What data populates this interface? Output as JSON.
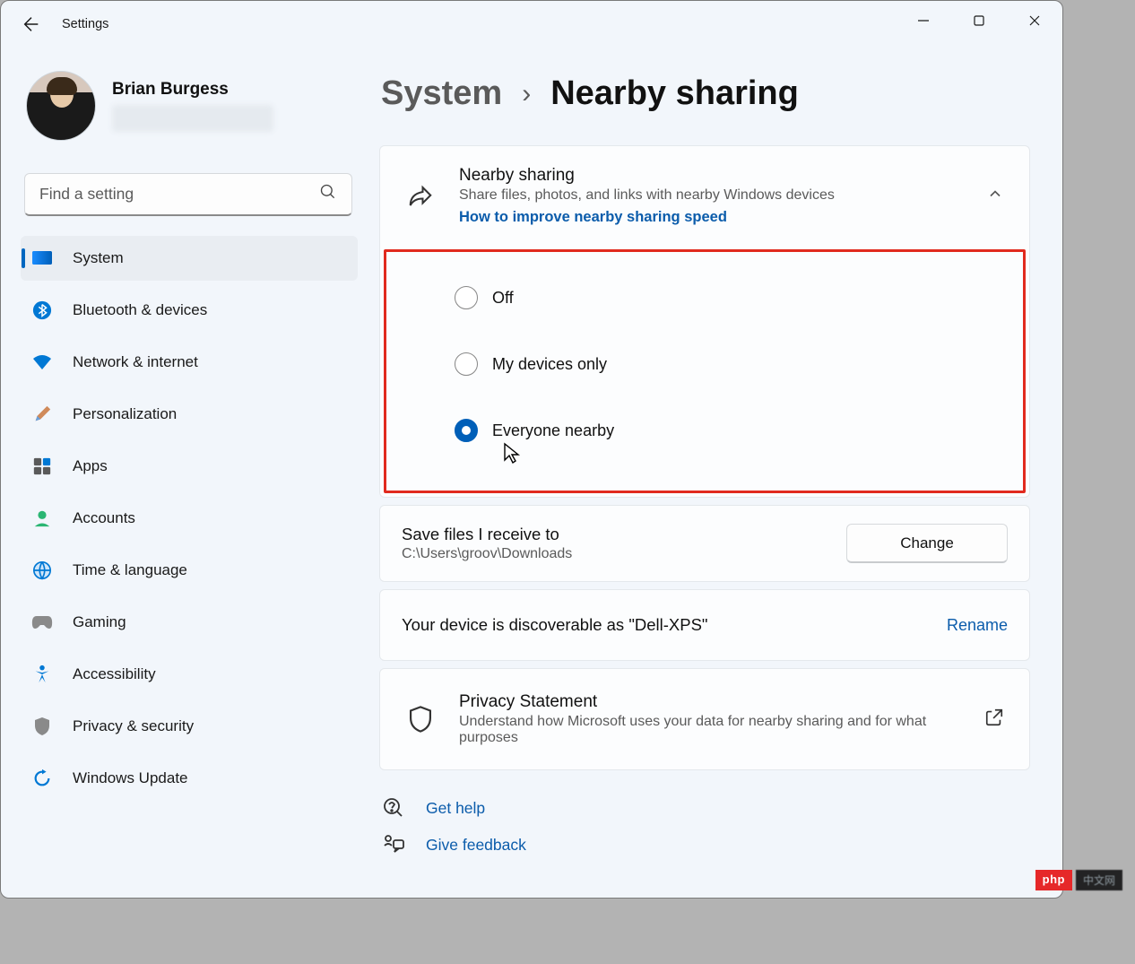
{
  "app_title": "Settings",
  "user": {
    "name": "Brian Burgess"
  },
  "search": {
    "placeholder": "Find a setting"
  },
  "sidebar": {
    "items": [
      {
        "label": "System"
      },
      {
        "label": "Bluetooth & devices"
      },
      {
        "label": "Network & internet"
      },
      {
        "label": "Personalization"
      },
      {
        "label": "Apps"
      },
      {
        "label": "Accounts"
      },
      {
        "label": "Time & language"
      },
      {
        "label": "Gaming"
      },
      {
        "label": "Accessibility"
      },
      {
        "label": "Privacy & security"
      },
      {
        "label": "Windows Update"
      }
    ]
  },
  "breadcrumb": {
    "parent": "System",
    "current": "Nearby sharing"
  },
  "nearby": {
    "title": "Nearby sharing",
    "subtitle": "Share files, photos, and links with nearby Windows devices",
    "link": "How to improve nearby sharing speed",
    "options": {
      "off": "Off",
      "my_devices": "My devices only",
      "everyone": "Everyone nearby"
    },
    "selected": "everyone"
  },
  "save": {
    "title": "Save files I receive to",
    "path": "C:\\Users\\groov\\Downloads",
    "button": "Change"
  },
  "discover": {
    "text": "Your device is discoverable as \"Dell-XPS\"",
    "rename": "Rename"
  },
  "privacy": {
    "title": "Privacy Statement",
    "subtitle": "Understand how Microsoft uses your data for nearby sharing and for what purposes"
  },
  "help": {
    "get_help": "Get help",
    "feedback": "Give feedback"
  },
  "badge": {
    "left": "php",
    "right": "中文网"
  }
}
